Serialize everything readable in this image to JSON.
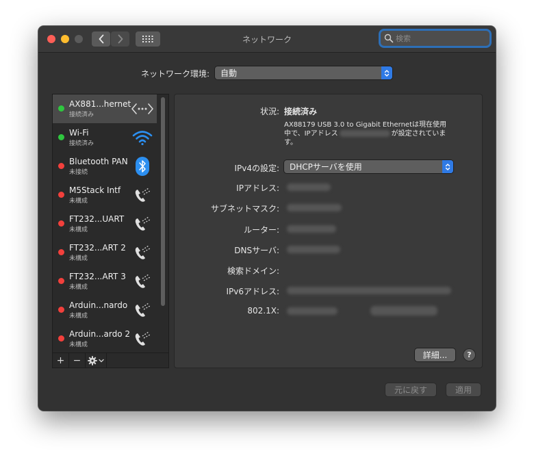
{
  "window": {
    "title": "ネットワーク"
  },
  "search": {
    "placeholder": "検索"
  },
  "location": {
    "label": "ネットワーク環境:",
    "value": "自動"
  },
  "services": [
    {
      "name": "AX881...hernet",
      "status": "接続済み",
      "state": "connected",
      "icon": "ethernet-icon",
      "selected": true
    },
    {
      "name": "Wi-Fi",
      "status": "接続済み",
      "state": "connected",
      "icon": "wifi-icon"
    },
    {
      "name": "Bluetooth PAN",
      "status": "未接続",
      "state": "disconnected",
      "icon": "bluetooth-icon"
    },
    {
      "name": "M5Stack Intf",
      "status": "未構成",
      "state": "not-configured",
      "icon": "phone-icon"
    },
    {
      "name": "FT232...UART",
      "status": "未構成",
      "state": "not-configured",
      "icon": "phone-icon"
    },
    {
      "name": "FT232...ART 2",
      "status": "未構成",
      "state": "not-configured",
      "icon": "phone-icon"
    },
    {
      "name": "FT232...ART 3",
      "status": "未構成",
      "state": "not-configured",
      "icon": "phone-icon"
    },
    {
      "name": "Arduin...nardo",
      "status": "未構成",
      "state": "not-configured",
      "icon": "phone-icon"
    },
    {
      "name": "Arduin...ardo 2",
      "status": "未構成",
      "state": "not-configured",
      "icon": "phone-icon"
    }
  ],
  "sidebar_toolbar": {
    "add": "+",
    "remove": "−"
  },
  "detail": {
    "status_label": "状況:",
    "status_value": "接続済み",
    "desc_line1": "AX88179 USB 3.0 to Gigabit Ethernetは現在使用",
    "desc_line2_a": "中で、IPアドレス",
    "desc_line2_b": "が設定されていま",
    "desc_line3": "す。",
    "ipv4_label": "IPv4の設定:",
    "ipv4_value": "DHCPサーバを使用",
    "ip_label": "IPアドレス:",
    "subnet_label": "サブネットマスク:",
    "router_label": "ルーター:",
    "dns_label": "DNSサーバ:",
    "search_domain_label": "検索ドメイン:",
    "ipv6_label": "IPv6アドレス:",
    "dot1x_label": "802.1X:",
    "advanced_button": "詳細...",
    "help_button": "?"
  },
  "footer": {
    "revert_button": "元に戻す",
    "apply_button": "適用"
  },
  "colors": {
    "connected": "#2fc73f",
    "disconnected": "#f2403c",
    "accent": "#2f7ae5"
  }
}
